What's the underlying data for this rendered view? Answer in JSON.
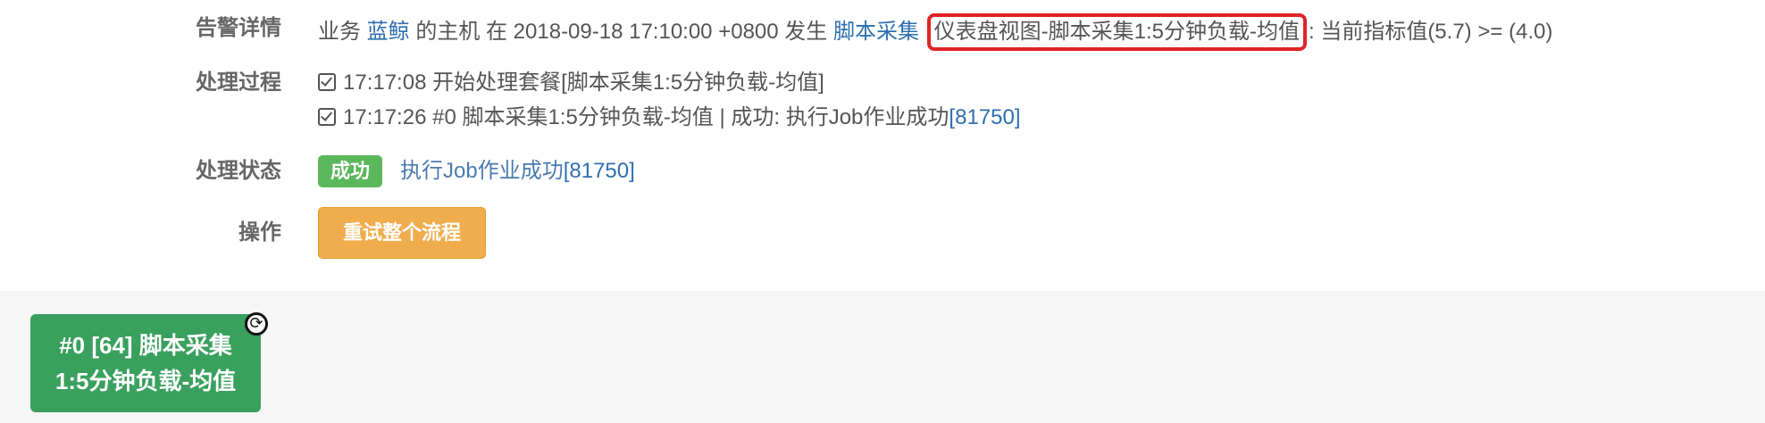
{
  "alert_detail": {
    "label": "告警详情",
    "prefix": "业务",
    "business": "蓝鲸",
    "mid1": "的主机 在 2018-09-18 17:10:00 +0800 发生",
    "collector": "脚本采集",
    "highlight": "仪表盘视图-脚本采集1:5分钟负载-均值",
    "suffix": ": 当前指标值(5.7) >= (4.0)"
  },
  "process": {
    "label": "处理过程",
    "steps": [
      {
        "text": "17:17:08 开始处理套餐[脚本采集1:5分钟负载-均值]",
        "link": ""
      },
      {
        "text": "17:17:26 #0 脚本采集1:5分钟负载-均值 | 成功: 执行Job作业成功",
        "link": "[81750]"
      }
    ]
  },
  "status": {
    "label": "处理状态",
    "badge": "成功",
    "text": "执行Job作业成功",
    "link": "[81750]"
  },
  "operation": {
    "label": "操作",
    "retry_button": "重试整个流程"
  },
  "flow_node": {
    "line1": "#0 [64] 脚本采集",
    "line2": "1:5分钟负载-均值"
  }
}
